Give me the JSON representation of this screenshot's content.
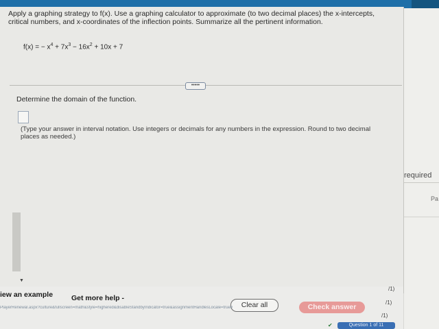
{
  "prompt": {
    "line1": "Apply a graphing strategy to f(x). Use a graphing calculator to approximate (to two decimal places) the x-intercepts,",
    "line2": "critical numbers, and x-coordinates of the inflection points. Summarize all the pertinent information."
  },
  "formula": {
    "lhs": "f(x) = − x",
    "exp4": "4",
    "t2": " + 7x",
    "exp3": "3",
    "t3": " − 16x",
    "exp2": "2",
    "t4": " + 10x + 7"
  },
  "expand_button": "•••••",
  "question": "Determine the domain of the function.",
  "hint": "(Type your answer in interval notation. Use integers or decimals for any numbers in the expression. Round to two decimal places as needed.)",
  "footer": {
    "view_example": "iew an example",
    "get_more_help": "Get more help -",
    "clear_all": "Clear all",
    "check_answer": "Check answer",
    "url_text": "PlayerRenewal.aspx?culture&fullscreen=math&style=highered&disableStandbyIndicator=true&assignmentHandlesLocale=true#",
    "question_nav": "Question 1 of 11"
  },
  "right": {
    "required": "required",
    "pa": "Pa",
    "marks": [
      "/1)",
      "/1)",
      "/1)"
    ]
  },
  "colors": {
    "topbar": "#1e6fa8",
    "check_answer_bg": "#e79a98"
  }
}
